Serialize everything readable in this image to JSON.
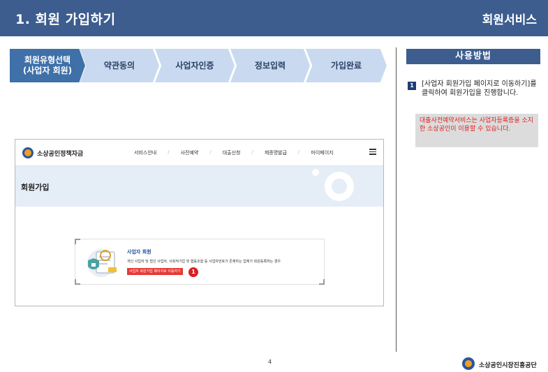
{
  "header": {
    "title": "1. 회원 가입하기",
    "service": "회원서비스"
  },
  "steps": [
    {
      "label": "회원유형선택\n(사업자 회원)",
      "active": true
    },
    {
      "label": "약관동의",
      "active": false
    },
    {
      "label": "사업자인증",
      "active": false
    },
    {
      "label": "정보입력",
      "active": false
    },
    {
      "label": "가입완료",
      "active": false
    }
  ],
  "usage": {
    "title": "사용방법",
    "step_number": "1",
    "step_text": "[사업자 회원가입 페이지로 이동하기]를 클릭하여 회원가입을 진행합니다.",
    "notice": "대출사전예약서비스는 사업자등록증을 소지한 소상공인이 이용할 수 있습니다."
  },
  "screenshot": {
    "logo": "소상공인정책자금",
    "menu": [
      "서비스안내",
      "사전예약",
      "대출신청",
      "제증명발급",
      "마이페이지"
    ],
    "banner_title": "회원가입",
    "card": {
      "title": "사업자 회원",
      "desc": "개인 사업자 및 법인 사업자, 사회적기업 및 협동조합 등 사업자번호가 존재하는 업체가 회원등록하는 경우",
      "button": "사업자 회원가입 페이지로 이동하기",
      "marker": "1"
    }
  },
  "footer": {
    "page": "4",
    "org": "소상공인시장진흥공단"
  },
  "colors": {
    "header": "#3d5d8f",
    "step_active": "#3f70a8",
    "step_inactive": "#c9daf0",
    "notice_text": "#e02020",
    "marker": "#d92020"
  }
}
